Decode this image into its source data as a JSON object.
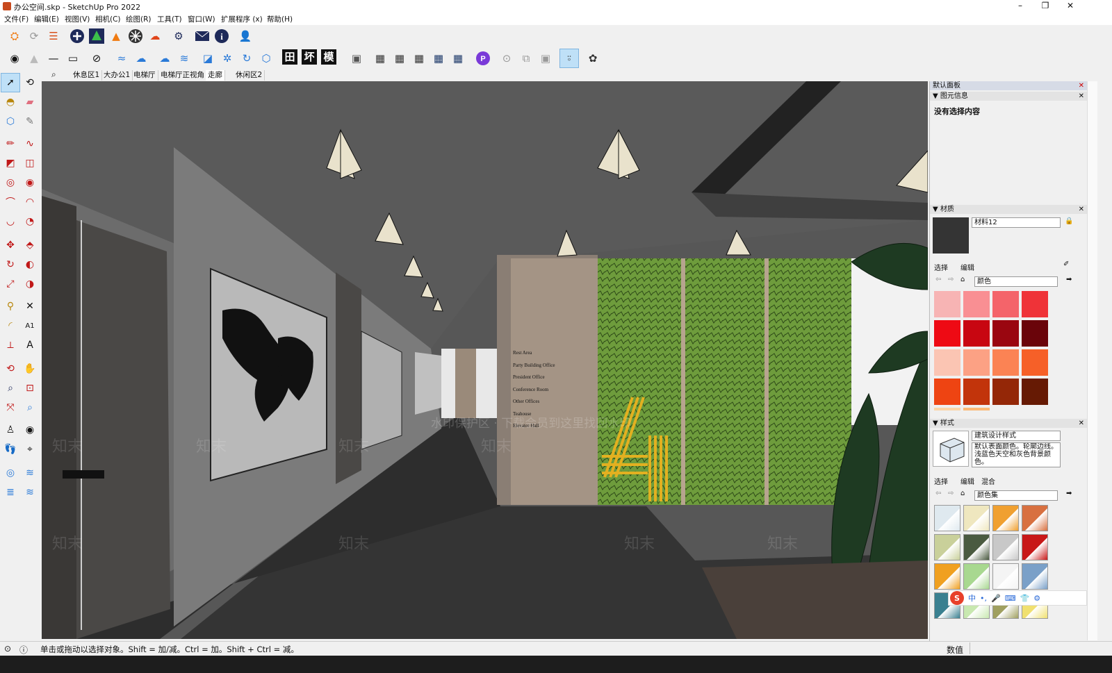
{
  "window": {
    "title": "办公空间.skp - SketchUp Pro 2022",
    "minimize": "–",
    "restore": "❐",
    "close": "✕"
  },
  "menu": [
    "文件(F)",
    "编辑(E)",
    "视图(V)",
    "相机(C)",
    "绘图(R)",
    "工具(T)",
    "窗口(W)",
    "扩展程序 (x)",
    "帮助(H)"
  ],
  "toolbar2_text_buttons": [
    "田",
    "坏",
    "模"
  ],
  "scenes": {
    "tabs": [
      "休息区1",
      "大办公1",
      "电梯厅",
      "电梯厅正视角",
      "走廊",
      "休闲区2"
    ],
    "active": "走廊"
  },
  "viewport": {
    "watermark_repeat": "知末",
    "watermark_banner": "水印保护区 · 下载会员到这里找回水印"
  },
  "signage": [
    "Rest Area",
    "Party Building Office",
    "President Office",
    "Conference Room",
    "Other Offices",
    "Teahouse",
    "Elevator Hall"
  ],
  "right_panel": {
    "tray_title": "默认面板",
    "entity_info": {
      "title": "图元信息",
      "empty_text": "没有选择内容"
    },
    "materials": {
      "title": "材质",
      "material_name": "材料12",
      "tabs": [
        "选择",
        "编辑"
      ],
      "library": "颜色",
      "swatches": [
        "#f7b4b4",
        "#f98f93",
        "#f4646a",
        "#ef3338",
        "#ee0a14",
        "#c80611",
        "#9a0610",
        "#6a040a",
        "#fbc5b3",
        "#fca184",
        "#fb8354",
        "#f66028",
        "#ee4412",
        "#c2340b",
        "#942707",
        "#661a04",
        "#fbd5a8",
        "#fbb977"
      ]
    },
    "styles": {
      "title": "样式",
      "style_name": "建筑设计样式",
      "description": "默认表面颜色。轮廓边线。浅蓝色天空和灰色背景颜色。",
      "tabs": [
        "选择",
        "编辑",
        "混合"
      ],
      "library": "颜色集"
    }
  },
  "status": {
    "message": "单击或拖动以选择对象。Shift = 加/减。Ctrl = 加。Shift + Ctrl = 减。",
    "value_label": "数值"
  },
  "ime": {
    "items": [
      "中",
      "•,",
      "🎤",
      "⌨",
      "👕",
      "⚙"
    ]
  }
}
